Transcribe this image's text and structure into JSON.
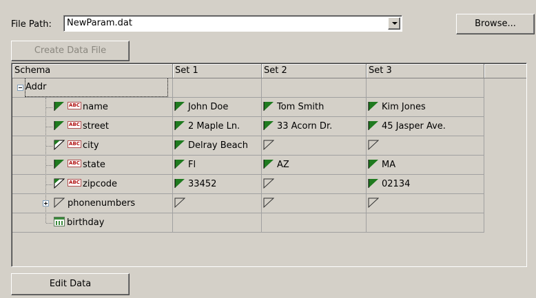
{
  "toolbar": {
    "file_path_label": "File Path:",
    "file_path_value": "NewParam.dat",
    "browse_label": "Browse...",
    "create_label": "Create Data File",
    "edit_label": "Edit Data"
  },
  "grid": {
    "headers": [
      "Schema",
      "Set 1",
      "Set 2",
      "Set 3"
    ],
    "root": {
      "label": "Addr",
      "expanded": true
    },
    "rows": [
      {
        "label": "name",
        "type": "string",
        "flag": "filled",
        "sets": [
          {
            "value": "John Doe",
            "flag": "filled"
          },
          {
            "value": "Tom Smith",
            "flag": "filled"
          },
          {
            "value": "Kim Jones",
            "flag": "filled"
          }
        ]
      },
      {
        "label": "street",
        "type": "string",
        "flag": "filled",
        "sets": [
          {
            "value": "2 Maple Ln.",
            "flag": "filled"
          },
          {
            "value": "33 Acorn Dr.",
            "flag": "filled"
          },
          {
            "value": "45 Jasper Ave.",
            "flag": "filled"
          }
        ]
      },
      {
        "label": "city",
        "type": "string",
        "flag": "partial",
        "sets": [
          {
            "value": "Delray Beach",
            "flag": "filled"
          },
          {
            "value": "",
            "flag": "empty"
          },
          {
            "value": "",
            "flag": "empty"
          }
        ]
      },
      {
        "label": "state",
        "type": "string",
        "flag": "filled",
        "sets": [
          {
            "value": "Fl",
            "flag": "filled"
          },
          {
            "value": "AZ",
            "flag": "filled"
          },
          {
            "value": "MA",
            "flag": "filled"
          }
        ]
      },
      {
        "label": "zipcode",
        "type": "string",
        "flag": "partial",
        "sets": [
          {
            "value": "33452",
            "flag": "filled"
          },
          {
            "value": "",
            "flag": "empty"
          },
          {
            "value": "02134",
            "flag": "filled"
          }
        ]
      },
      {
        "label": "phonenumbers",
        "type": "group",
        "flag": "empty",
        "sets": [
          {
            "value": "",
            "flag": "empty"
          },
          {
            "value": "",
            "flag": "empty"
          },
          {
            "value": "",
            "flag": "empty"
          }
        ]
      },
      {
        "label": "birthday",
        "type": "date",
        "flag": "none",
        "sets": [
          {
            "value": "",
            "flag": "none"
          },
          {
            "value": "",
            "flag": "none"
          },
          {
            "value": "",
            "flag": "none"
          }
        ]
      }
    ]
  },
  "icons": {
    "string_type": "abc-string-icon",
    "date_type": "calendar-icon",
    "flag_filled": "green-flag-icon",
    "flag_partial": "partial-flag-icon",
    "flag_empty": "empty-flag-icon"
  },
  "type_badge_text": "ABC",
  "colors": {
    "flag_green": "#1f7a1f",
    "background": "#d4d0c8"
  }
}
